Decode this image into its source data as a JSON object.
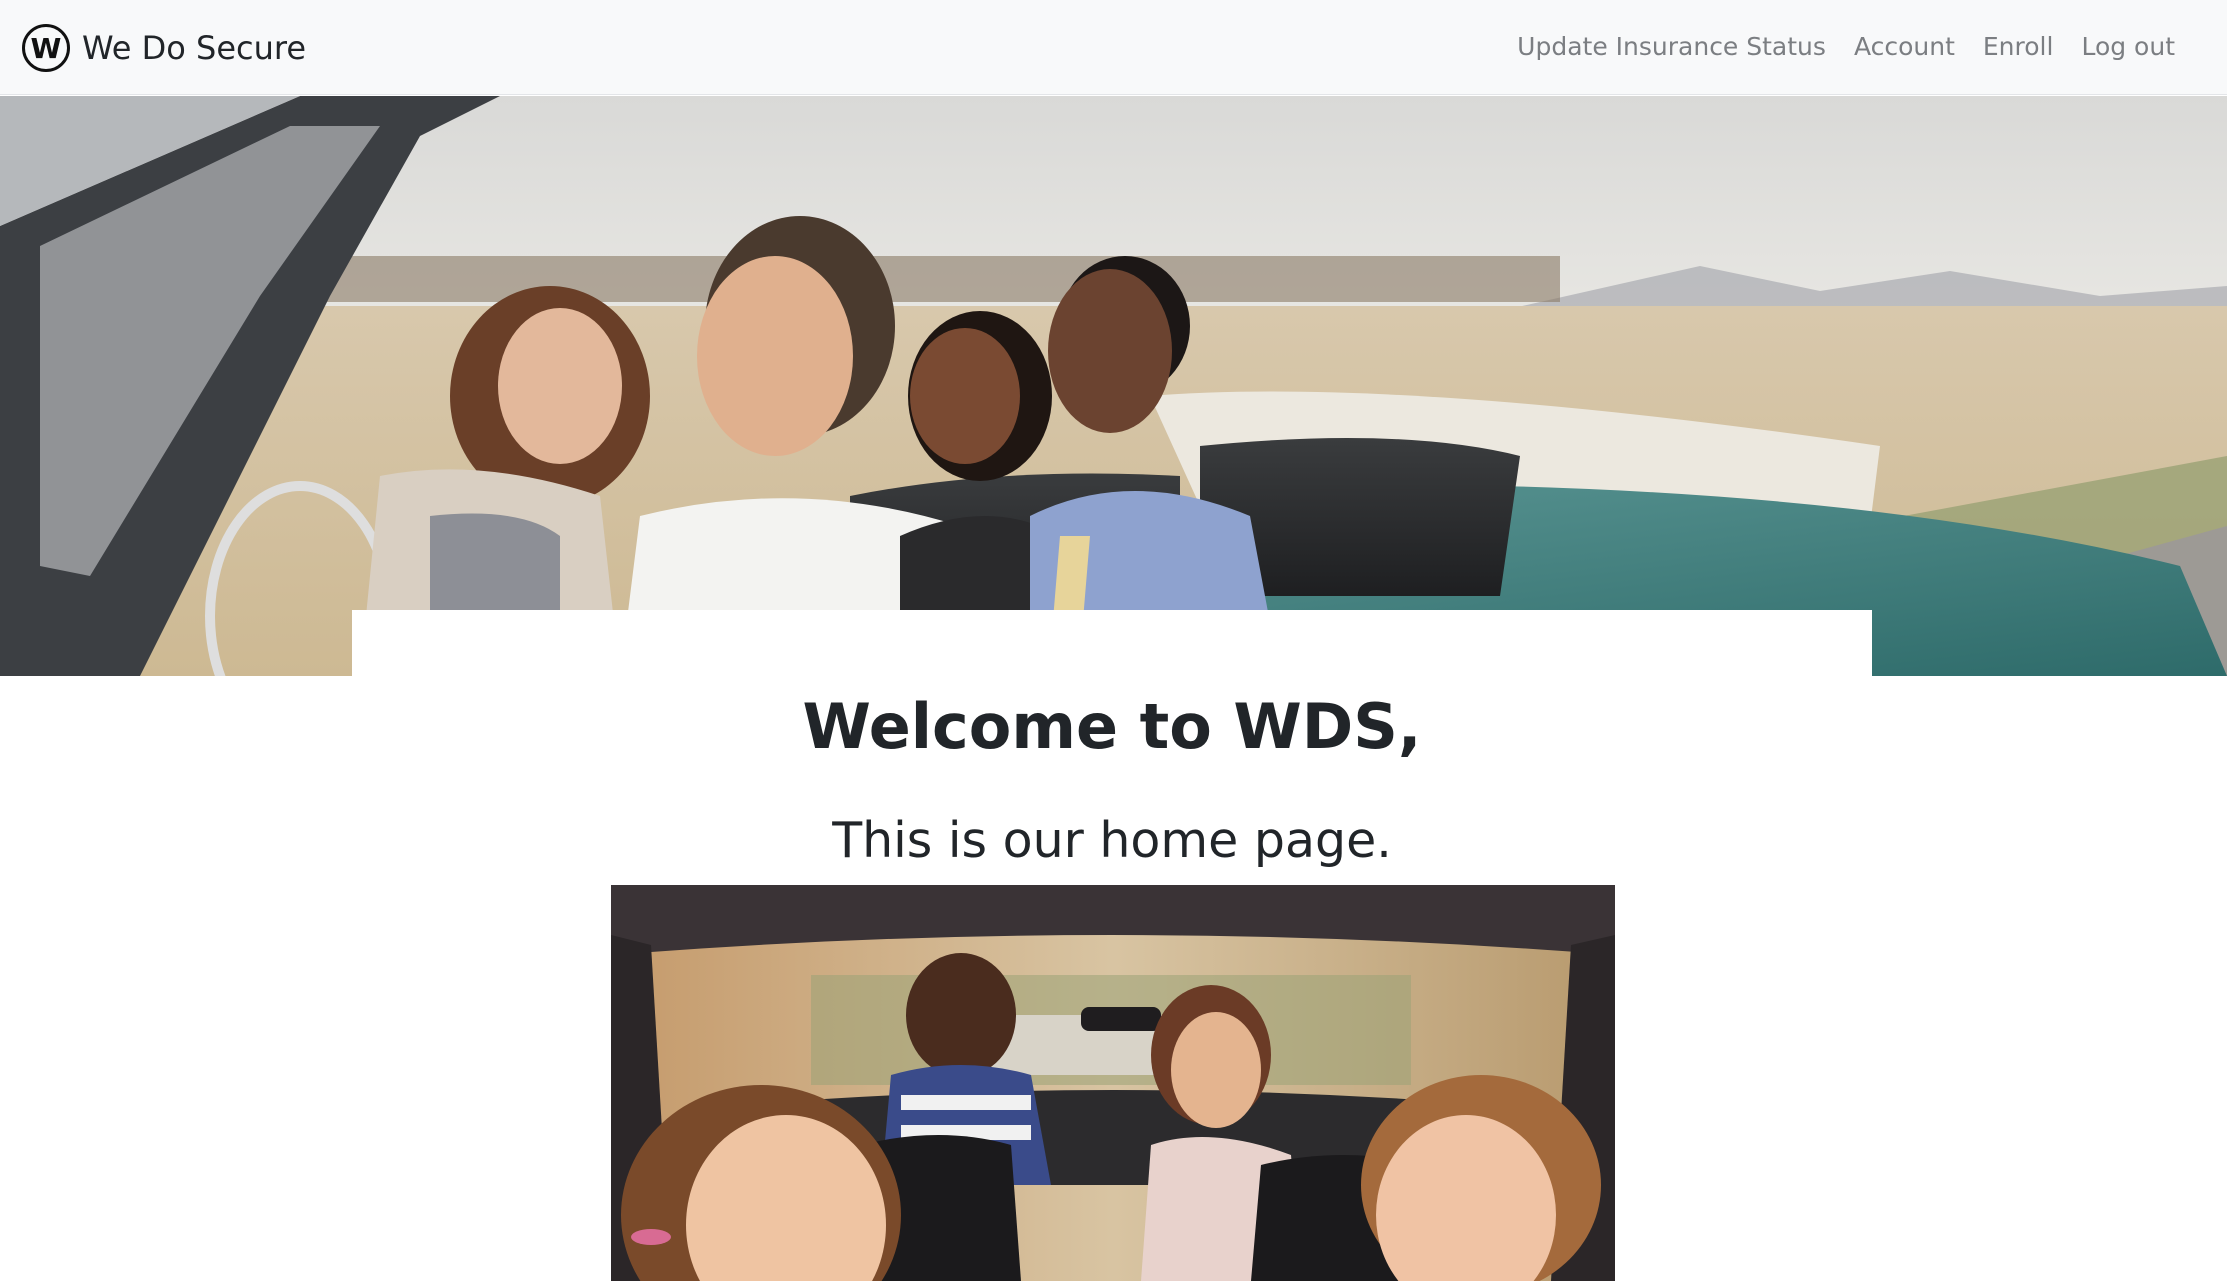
{
  "navbar": {
    "brand_letter": "W",
    "brand_name": "We Do Secure",
    "links": [
      {
        "label": "Update Insurance Status"
      },
      {
        "label": "Account"
      },
      {
        "label": "Enroll"
      },
      {
        "label": "Log out"
      }
    ]
  },
  "main": {
    "welcome_heading": "Welcome to WDS,",
    "sub_heading": "This is our home page."
  },
  "colors": {
    "navbar_bg": "#f8f9fa",
    "nav_link": "#7b7e82",
    "text": "#212529"
  }
}
